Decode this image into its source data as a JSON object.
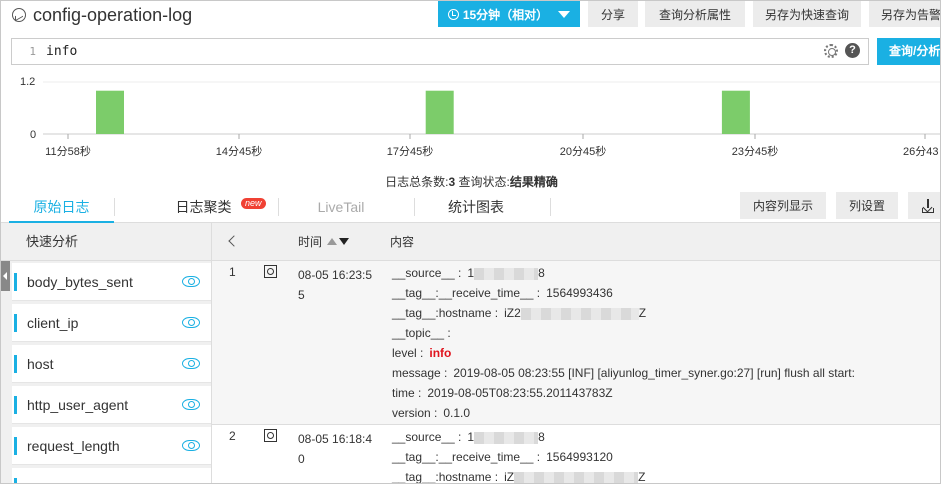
{
  "header": {
    "title": "config-operation-log",
    "time_range_label": "15分钟（相对）",
    "buttons": [
      "分享",
      "查询分析属性",
      "另存为快速查询",
      "另存为告警"
    ]
  },
  "query": {
    "line_number": "1",
    "text": "info",
    "help_label": "?",
    "search_button": "查询/分析"
  },
  "histogram": {
    "chart_data": {
      "type": "bar",
      "ylim": [
        0,
        1.2
      ],
      "y_ticks": [
        "1.2",
        "0"
      ],
      "x_ticks": [
        "11分58秒",
        "14分45秒",
        "17分45秒",
        "20分45秒",
        "23分45秒",
        "26分43"
      ],
      "bars": [
        {
          "position": "12分30秒",
          "value": 1
        },
        {
          "position": "18分15秒",
          "value": 1
        },
        {
          "position": "23分25秒",
          "value": 1
        }
      ]
    }
  },
  "summary": {
    "count_label": "日志总条数:",
    "count_value": "3",
    "status_label": "查询状态:",
    "status_value": "结果精确"
  },
  "tabs": [
    {
      "label": "原始日志"
    },
    {
      "label": "日志聚类",
      "badge": "new"
    },
    {
      "label": "LiveTail"
    },
    {
      "label": "统计图表"
    }
  ],
  "toolbar": {
    "content_display": "内容列显示",
    "column_settings": "列设置"
  },
  "sidebar": {
    "title": "快速分析",
    "fields": [
      "body_bytes_sent",
      "client_ip",
      "host",
      "http_user_agent",
      "request_length"
    ]
  },
  "table": {
    "time_header": "时间",
    "content_header": "内容",
    "rows": [
      {
        "index": "1",
        "time": "08-05 16:23:55",
        "fields": [
          {
            "key": "__source__ :",
            "prefix": "1",
            "suffix": "8"
          },
          {
            "key": "__tag__:__receive_time__ :",
            "value": "1564993436"
          },
          {
            "key": "__tag__:hostname :",
            "prefix": "iZ2",
            "suffix": "Z"
          },
          {
            "key": "__topic__ :",
            "value": ""
          },
          {
            "key": "level :",
            "value": "info"
          },
          {
            "key": "message :",
            "value": "2019-08-05 08:23:55 [INF] [aliyunlog_timer_syner.go:27] [run] flush all start:"
          },
          {
            "key": "time :",
            "value": "2019-08-05T08:23:55.201143783Z"
          },
          {
            "key": "version :",
            "value": "0.1.0"
          }
        ]
      },
      {
        "index": "2",
        "time": "08-05 16:18:40",
        "fields": [
          {
            "key": "__source__ :",
            "prefix": "1",
            "suffix": "8"
          },
          {
            "key": "__tag__:__receive_time__ :",
            "value": "1564993120"
          },
          {
            "key": "__tag__:hostname :",
            "prefix": "iZ",
            "suffix": "Z"
          }
        ]
      }
    ]
  }
}
